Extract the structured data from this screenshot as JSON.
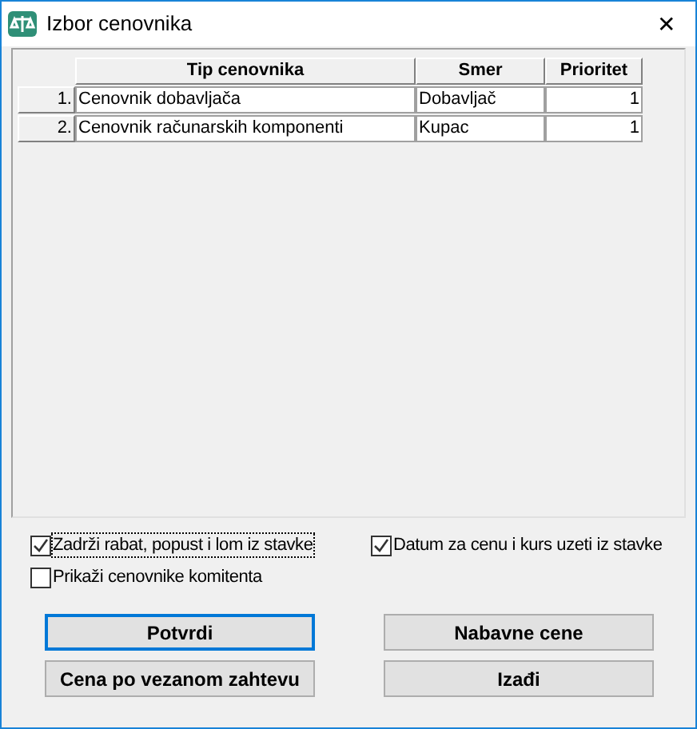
{
  "window": {
    "title": "Izbor cenovnika",
    "close": "✕"
  },
  "table": {
    "columns": [
      "Tip cenovnika",
      "Smer",
      "Prioritet"
    ],
    "rows": [
      {
        "number": "1.",
        "cells": [
          "Cenovnik dobavljača",
          "Dobavljač",
          "1"
        ]
      },
      {
        "number": "2.",
        "cells": [
          "Cenovnik računarskih komponenti",
          "Kupac",
          "1"
        ]
      }
    ]
  },
  "options": [
    {
      "label": "Zadrži rabat, popust i lom iz stavke",
      "checked": true,
      "focused": true
    },
    {
      "label": "Datum za cenu i kurs uzeti iz stavke",
      "checked": true,
      "focused": false
    },
    {
      "label": "Prikaži cenovnike komitenta",
      "checked": false,
      "focused": false
    }
  ],
  "buttons": [
    {
      "label": "Potvrdi",
      "default": true
    },
    {
      "label": "Nabavne cene",
      "default": false
    },
    {
      "label": "Cena po vezanom zahtevu",
      "default": false
    },
    {
      "label": "Izađi",
      "default": false
    }
  ]
}
